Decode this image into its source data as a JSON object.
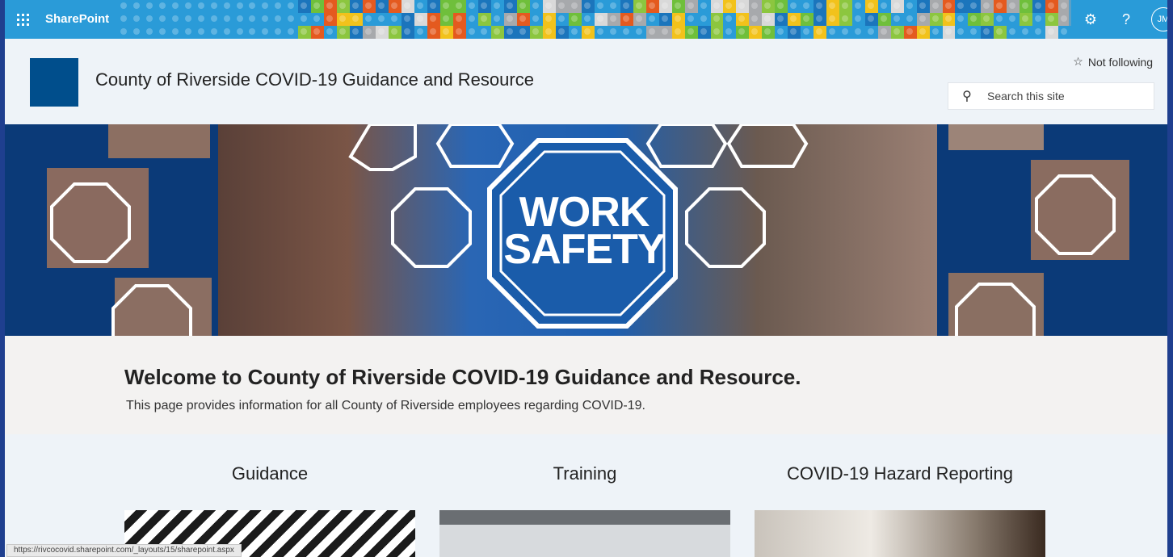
{
  "suite": {
    "app_name": "SharePoint",
    "settings_icon": "gear-icon",
    "help_label": "?",
    "avatar_initials": "JM"
  },
  "site": {
    "title": "County of Riverside COVID-19 Guidance and Resource",
    "follow_label": "Not following",
    "search_placeholder": "Search this site"
  },
  "hero": {
    "sign_line1": "WORK",
    "sign_line2": "SAFETY"
  },
  "welcome": {
    "heading": "Welcome to County of Riverside COVID-19 Guidance and Resource.",
    "text": "This page provides information for all County of Riverside employees regarding COVID-19."
  },
  "sections": [
    {
      "title": "Guidance"
    },
    {
      "title": "Training"
    },
    {
      "title": "COVID-19 Hazard Reporting"
    }
  ],
  "status_url": "https://rivcocovid.sharepoint.com/_layouts/15/sharepoint.aspx",
  "colors": {
    "suite_bar": "#2a9bd8",
    "site_logo": "#004e8c",
    "hero_bg": "#0b3a78"
  }
}
